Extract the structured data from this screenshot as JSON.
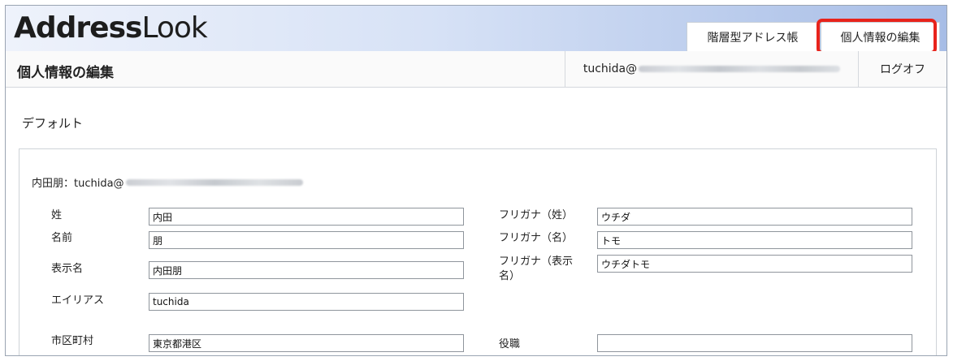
{
  "app": {
    "logo_bold": "Address",
    "logo_light": "Look"
  },
  "tabs": [
    {
      "label": "階層型アドレス帳"
    },
    {
      "label": "個人情報の編集",
      "active": true
    }
  ],
  "header": {
    "page_title": "個人情報の編集",
    "user_prefix": "tuchida@",
    "logoff_label": "ログオフ"
  },
  "section": {
    "title": "デフォルト",
    "identity_prefix": "内田朋：tuchida@"
  },
  "form": {
    "last_name_label": "姓",
    "last_name_value": "内田",
    "first_name_label": "名前",
    "first_name_value": "朋",
    "display_name_label": "表示名",
    "display_name_value": "内田朋",
    "alias_label": "エイリアス",
    "alias_value": "tuchida",
    "city_label": "市区町村",
    "city_value": "東京都港区",
    "furigana_last_label": "フリガナ（姓）",
    "furigana_last_value": "ウチダ",
    "furigana_first_label": "フリガナ（名）",
    "furigana_first_value": "トモ",
    "furigana_display_label_line1": "フリガナ（表示",
    "furigana_display_label_line2": "名）",
    "furigana_display_value": "ウチダトモ",
    "title_label": "役職",
    "title_value": ""
  },
  "colors": {
    "highlight": "#e8231b",
    "header_gradient_end": "#a7bde6"
  }
}
